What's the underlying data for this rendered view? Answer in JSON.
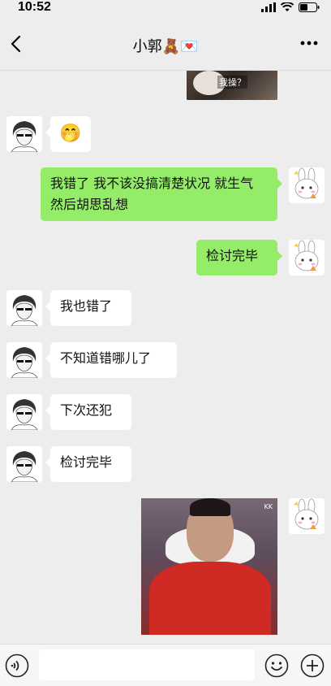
{
  "status_bar": {
    "time": "10:52"
  },
  "header": {
    "title": "小郭",
    "title_emoji": "🧸💌"
  },
  "top_image": {
    "caption": "我操？"
  },
  "messages": [
    {
      "side": "left",
      "type": "sticker",
      "text": "🤭"
    },
    {
      "side": "right",
      "type": "text",
      "text": "我错了 我不该没搞清楚状况 就生气 然后胡思乱想"
    },
    {
      "side": "right",
      "type": "text",
      "text": "检讨完毕"
    },
    {
      "side": "left",
      "type": "text",
      "text": "我也错了"
    },
    {
      "side": "left",
      "type": "text",
      "text": "不知道错哪儿了"
    },
    {
      "side": "left",
      "type": "text",
      "text": "下次还犯"
    },
    {
      "side": "left",
      "type": "text",
      "text": "检讨完毕"
    },
    {
      "side": "right",
      "type": "image",
      "text": "KK"
    }
  ],
  "input": {
    "value": ""
  },
  "colors": {
    "bg": "#ededed",
    "bubble_self": "#95ec69",
    "bubble_other": "#ffffff"
  },
  "icons": [
    "back-icon",
    "more-icon",
    "voice-icon",
    "emoji-icon",
    "plus-icon",
    "signal-icon",
    "wifi-icon",
    "battery-icon"
  ]
}
